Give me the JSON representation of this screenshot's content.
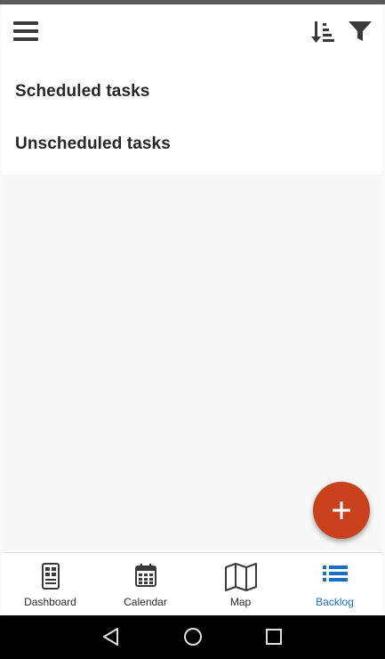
{
  "app": {
    "sections": [
      {
        "label": "Scheduled tasks"
      },
      {
        "label": "Unscheduled tasks"
      }
    ]
  },
  "bottom_nav": {
    "items": [
      {
        "label": "Dashboard",
        "icon": "dashboard-icon"
      },
      {
        "label": "Calendar",
        "icon": "calendar-icon"
      },
      {
        "label": "Map",
        "icon": "map-icon"
      },
      {
        "label": "Backlog",
        "icon": "backlog-list-icon"
      }
    ],
    "active": "Backlog"
  },
  "icons": {
    "menu": "hamburger-menu-icon",
    "sort": "sort-icon",
    "filter": "filter-icon",
    "fab": "plus-icon",
    "system": [
      "back-icon",
      "home-icon",
      "recents-icon"
    ]
  },
  "colors": {
    "fab_background": "#c8401c",
    "active_nav": "#1a6fc4",
    "status_bar": "#5a5a5a",
    "system_nav": "#000000"
  }
}
